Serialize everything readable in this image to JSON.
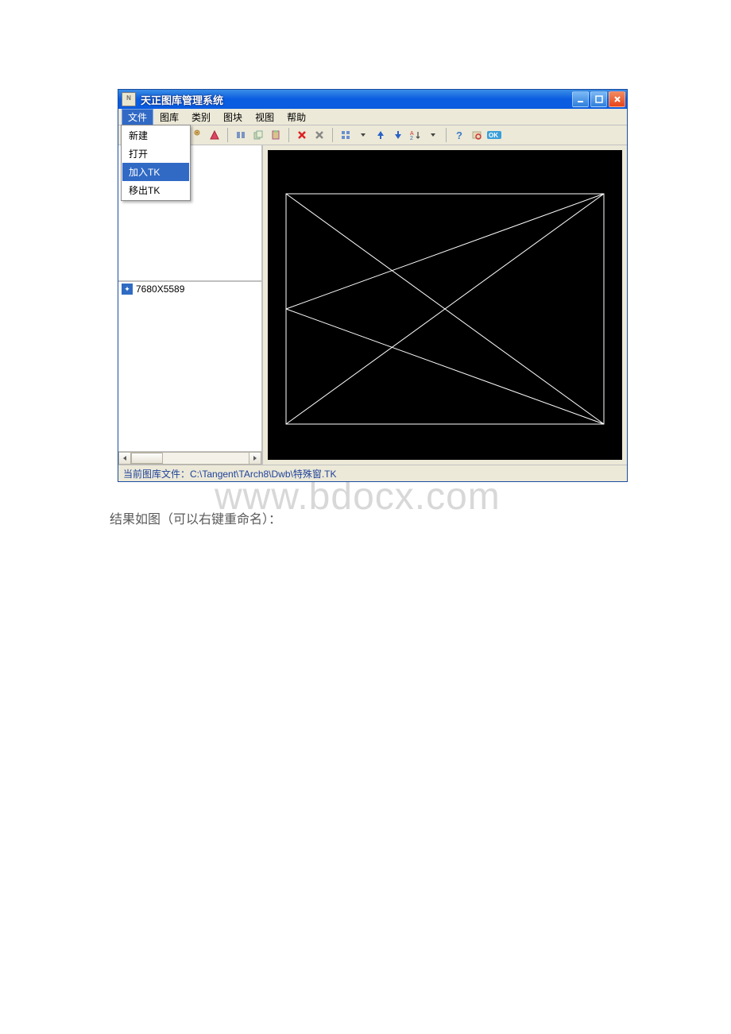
{
  "window": {
    "title": "天正图库管理系统"
  },
  "menubar": {
    "items": [
      "文件",
      "图库",
      "类别",
      "图块",
      "视图",
      "帮助"
    ],
    "active_index": 0
  },
  "dropdown": {
    "items": [
      "新建",
      "打开",
      "加入TK",
      "移出TK"
    ],
    "highlight_index": 2
  },
  "list": {
    "items": [
      {
        "icon": "block-icon",
        "label": "7680X5589"
      }
    ]
  },
  "statusbar": {
    "label_prefix": "当前图库文件：",
    "path": "C:\\Tangent\\TArch8\\Dwb\\特殊窗.TK"
  },
  "caption": "结果如图（可以右键重命名）：",
  "watermark": "www.bdocx.com"
}
